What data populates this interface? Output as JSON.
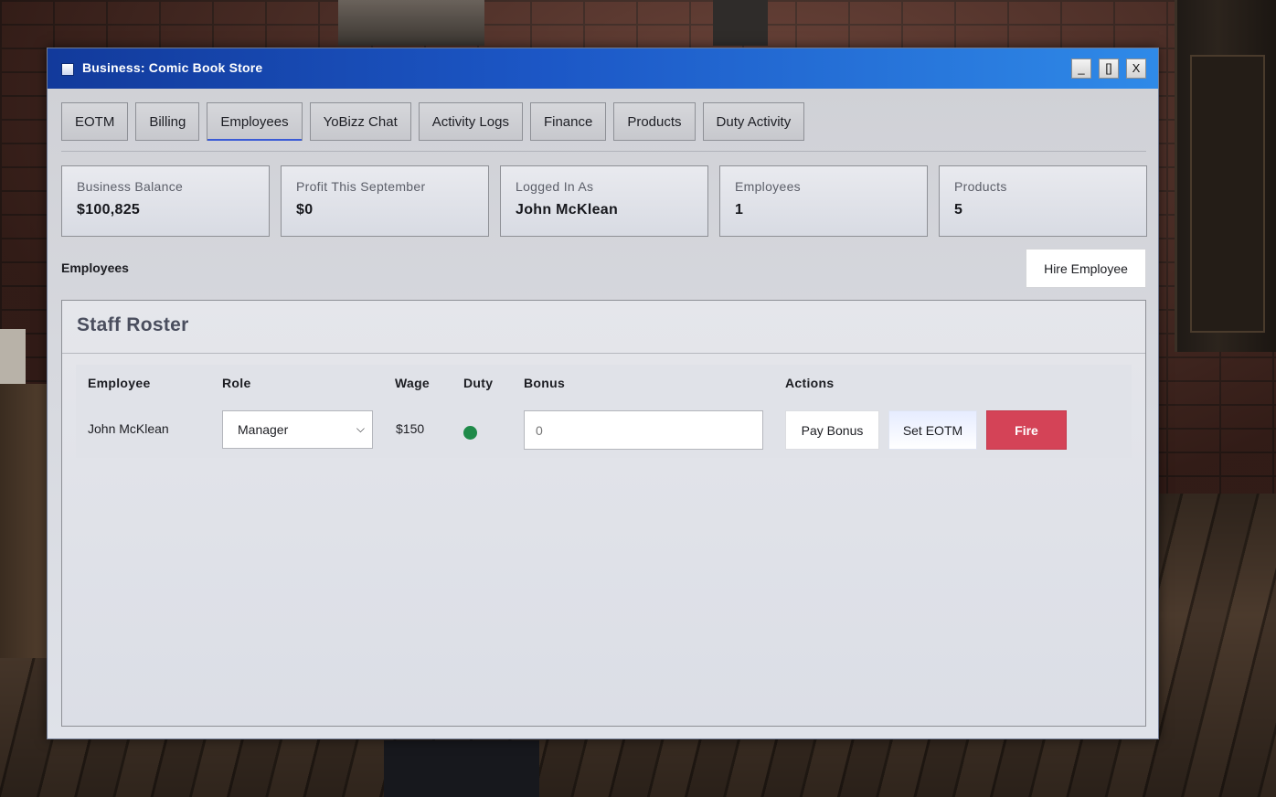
{
  "window": {
    "title": "Business: Comic Book Store",
    "controls": {
      "minimize": "_",
      "maximize": "[]",
      "close": "X"
    }
  },
  "tabs": [
    {
      "label": "EOTM",
      "active": false
    },
    {
      "label": "Billing",
      "active": false
    },
    {
      "label": "Employees",
      "active": true
    },
    {
      "label": "YoBizz Chat",
      "active": false
    },
    {
      "label": "Activity Logs",
      "active": false
    },
    {
      "label": "Finance",
      "active": false
    },
    {
      "label": "Products",
      "active": false
    },
    {
      "label": "Duty Activity",
      "active": false
    }
  ],
  "stats": [
    {
      "label": "Business Balance",
      "value": "$100,825"
    },
    {
      "label": "Profit This September",
      "value": "$0"
    },
    {
      "label": "Logged In As",
      "value": "John McKlean"
    },
    {
      "label": "Employees",
      "value": "1"
    },
    {
      "label": "Products",
      "value": "5"
    }
  ],
  "employees_section": {
    "heading": "Employees",
    "hire_label": "Hire Employee"
  },
  "roster": {
    "title": "Staff Roster",
    "columns": {
      "employee": "Employee",
      "role": "Role",
      "wage": "Wage",
      "duty": "Duty",
      "bonus": "Bonus",
      "actions": "Actions"
    },
    "rows": [
      {
        "employee": "John McKlean",
        "role": "Manager",
        "wage": "$150",
        "on_duty": true,
        "bonus_placeholder": "0",
        "actions": {
          "pay_bonus": "Pay Bonus",
          "set_eotm": "Set EOTM",
          "fire": "Fire"
        }
      }
    ]
  },
  "colors": {
    "titlebar_start": "#123a9b",
    "titlebar_end": "#2f8ae8",
    "active_tab_underline": "#3a5bd6",
    "duty_on": "#1f8a49",
    "fire_button": "#d44357"
  },
  "icons": {
    "window_icon": "window-icon",
    "role_dropdown": "chevron-down-icon",
    "duty_status": "status-dot-icon"
  }
}
